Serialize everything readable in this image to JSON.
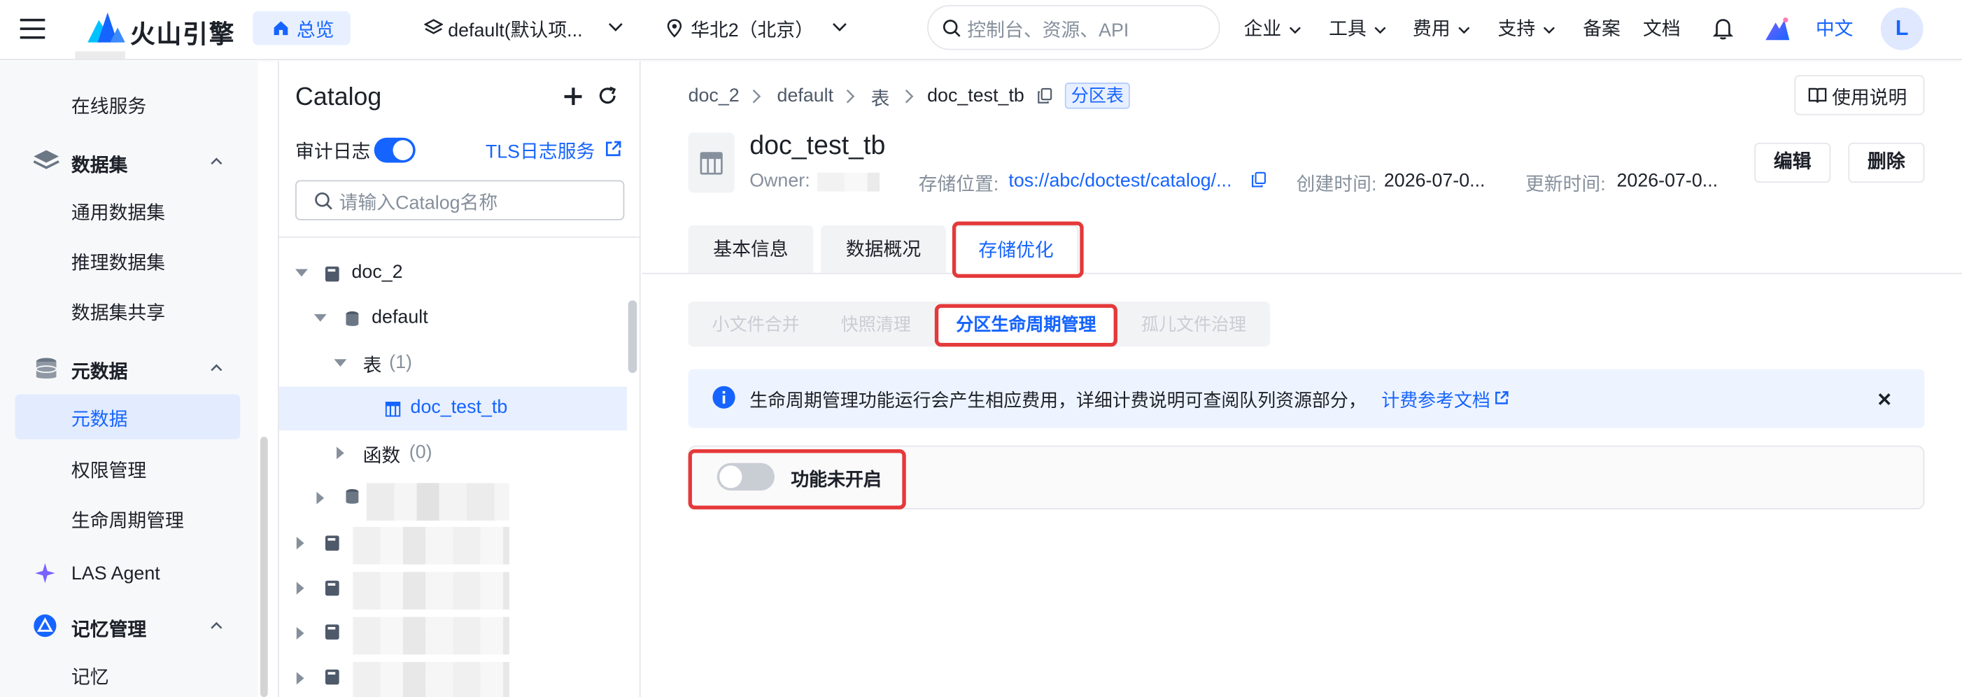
{
  "topbar": {
    "brand": "火山引擎",
    "home_label": "总览",
    "project_label": "default(默认项...",
    "region_label": "华北2（北京）",
    "search_placeholder": "控制台、资源、API",
    "nav": [
      "企业",
      "工具",
      "费用",
      "支持"
    ],
    "record_label": "备案",
    "docs_label": "文档",
    "lang_label": "中文",
    "avatar_letter": "L"
  },
  "sidebar": {
    "online_service": "在线服务",
    "dataset_group": "数据集",
    "dataset_items": [
      "通用数据集",
      "推理数据集",
      "数据集共享"
    ],
    "metadata_group": "元数据",
    "metadata_items": [
      "元数据",
      "权限管理",
      "生命周期管理"
    ],
    "las_agent": "LAS Agent",
    "memory_group": "记忆管理",
    "memory_items": [
      "记忆"
    ]
  },
  "catalog": {
    "title": "Catalog",
    "audit_label": "审计日志",
    "tls_link": "TLS日志服务",
    "search_placeholder": "请输入Catalog名称",
    "tree": {
      "root": "doc_2",
      "db": "default",
      "tables_label": "表",
      "tables_count": "(1)",
      "table_item": "doc_test_tb",
      "functions_label": "函数",
      "functions_count": "(0)"
    }
  },
  "main": {
    "breadcrumb": [
      "doc_2",
      "default",
      "表",
      "doc_test_tb"
    ],
    "badge": "分区表",
    "help_button": "使用说明",
    "table_title": "doc_test_tb",
    "owner_label": "Owner:",
    "storage_label": "存储位置:",
    "storage_value": "tos://abc/doctest/catalog/...",
    "created_label": "创建时间:",
    "created_value": "2026-07-0...",
    "updated_label": "更新时间:",
    "updated_value": "2026-07-0...",
    "edit_button": "编辑",
    "delete_button": "删除",
    "tabs": [
      "基本信息",
      "数据概况",
      "存储优化"
    ],
    "subtabs": [
      "小文件合并",
      "快照清理",
      "分区生命周期管理",
      "孤儿文件治理"
    ],
    "info_text": "生命周期管理功能运行会产生相应费用，详细计费说明可查阅队列资源部分，",
    "info_link": "计费参考文档",
    "toggle_label": "功能未开启"
  },
  "colors": {
    "accent": "#1664ff",
    "highlight_red": "#e5393a",
    "info_bg": "#eef4ff"
  }
}
